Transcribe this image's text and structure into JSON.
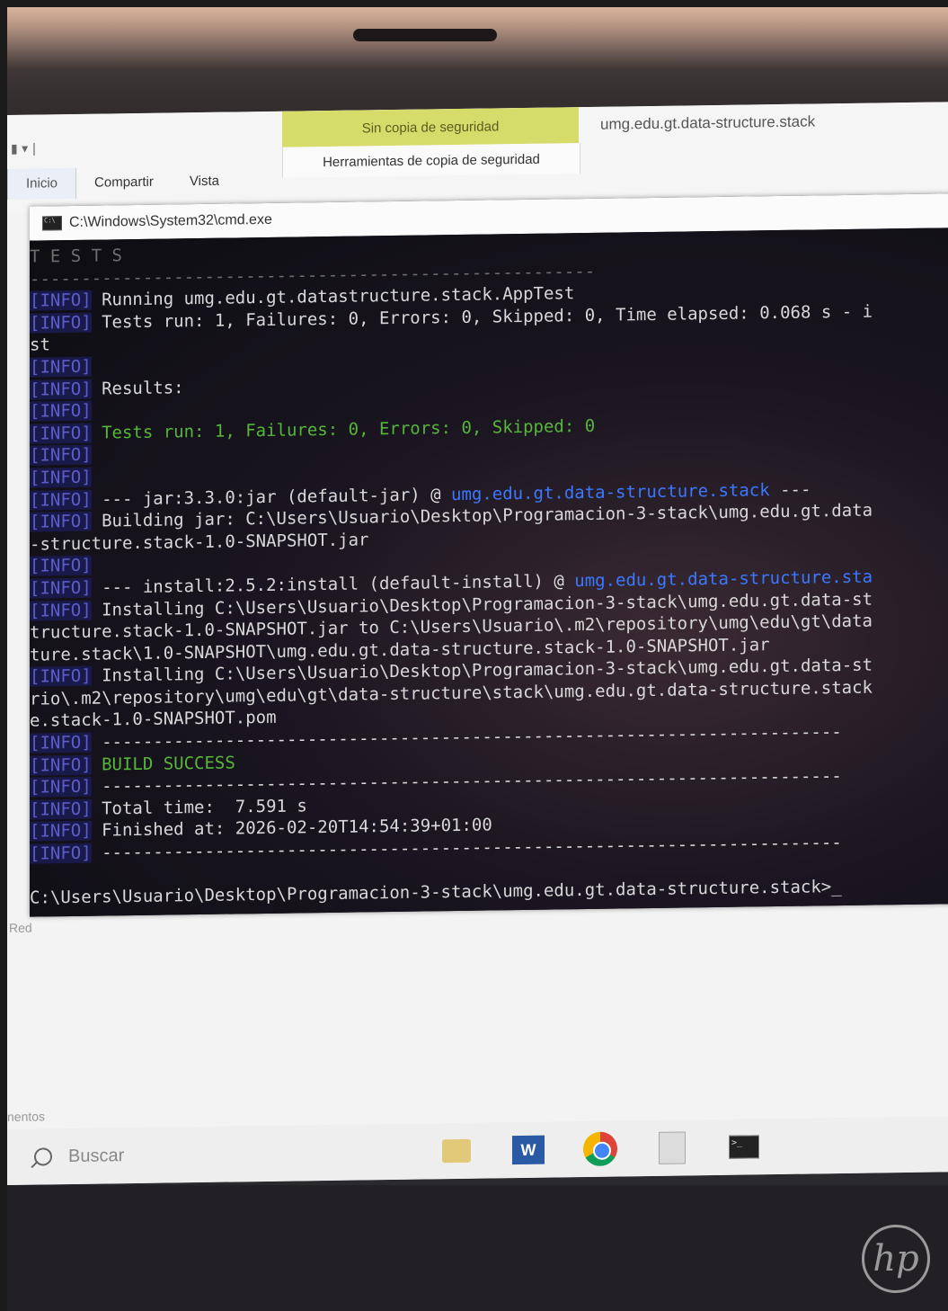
{
  "explorer": {
    "context_tab_top": "Sin copia de seguridad",
    "context_tab_bottom": "Herramientas de copia de seguridad",
    "title": "umg.edu.gt.data-structure.stack",
    "tabs": [
      "Inicio",
      "Compartir",
      "Vista"
    ]
  },
  "cmd": {
    "title": "C:\\Windows\\System32\\cmd.exe",
    "lines": [
      {
        "tag": "",
        "text": "T E S T S",
        "style": "dim"
      },
      {
        "tag": "",
        "text": "-------------------------------------------------------",
        "style": "dim"
      },
      {
        "tag": "[INFO]",
        "text": "Running umg.edu.gt.datastructure.stack.AppTest",
        "style": ""
      },
      {
        "tag": "[INFO]",
        "text": "Tests run: 1, Failures: 0, Errors: 0, Skipped: 0, Time elapsed: 0.068 s - i",
        "style": ""
      },
      {
        "tag": "",
        "text": "st",
        "style": ""
      },
      {
        "tag": "[INFO]",
        "text": "",
        "style": ""
      },
      {
        "tag": "[INFO]",
        "text": "Results:",
        "style": ""
      },
      {
        "tag": "[INFO]",
        "text": "",
        "style": ""
      },
      {
        "tag": "[INFO]",
        "text": "Tests run: 1, Failures: 0, Errors: 0, Skipped: 0",
        "style": "green"
      },
      {
        "tag": "[INFO]",
        "text": "",
        "style": ""
      },
      {
        "tag": "[INFO]",
        "text": "",
        "style": ""
      },
      {
        "tag": "[INFO]",
        "text": "--- jar:3.3.0:jar (default-jar) @ umg.edu.gt.data-structure.stack ---",
        "style": ""
      },
      {
        "tag": "[INFO]",
        "text": "Building jar: C:\\Users\\Usuario\\Desktop\\Programacion-3-stack\\umg.edu.gt.data",
        "style": ""
      },
      {
        "tag": "",
        "text": "-structure.stack-1.0-SNAPSHOT.jar",
        "style": ""
      },
      {
        "tag": "[INFO]",
        "text": "",
        "style": ""
      },
      {
        "tag": "[INFO]",
        "text": "--- install:2.5.2:install (default-install) @ umg.edu.gt.data-structure.sta",
        "style": ""
      },
      {
        "tag": "[INFO]",
        "text": "Installing C:\\Users\\Usuario\\Desktop\\Programacion-3-stack\\umg.edu.gt.data-st",
        "style": ""
      },
      {
        "tag": "",
        "text": "tructure.stack-1.0-SNAPSHOT.jar to C:\\Users\\Usuario\\.m2\\repository\\umg\\edu\\gt\\data",
        "style": ""
      },
      {
        "tag": "",
        "text": "ture.stack\\1.0-SNAPSHOT\\umg.edu.gt.data-structure.stack-1.0-SNAPSHOT.jar",
        "style": ""
      },
      {
        "tag": "[INFO]",
        "text": "Installing C:\\Users\\Usuario\\Desktop\\Programacion-3-stack\\umg.edu.gt.data-st",
        "style": ""
      },
      {
        "tag": "",
        "text": "rio\\.m2\\repository\\umg\\edu\\gt\\data-structure\\stack\\umg.edu.gt.data-structure.stack",
        "style": ""
      },
      {
        "tag": "",
        "text": "e.stack-1.0-SNAPSHOT.pom",
        "style": ""
      },
      {
        "tag": "[INFO]",
        "text": "------------------------------------------------------------------------",
        "style": ""
      },
      {
        "tag": "[INFO]",
        "text": "BUILD SUCCESS",
        "style": "green"
      },
      {
        "tag": "[INFO]",
        "text": "------------------------------------------------------------------------",
        "style": ""
      },
      {
        "tag": "[INFO]",
        "text": "Total time:  7.591 s",
        "style": ""
      },
      {
        "tag": "[INFO]",
        "text": "Finished at: 2026-02-20T14:54:39+01:00",
        "style": ""
      },
      {
        "tag": "[INFO]",
        "text": "------------------------------------------------------------------------",
        "style": ""
      },
      {
        "tag": "",
        "text": "",
        "style": ""
      },
      {
        "tag": "",
        "text": "C:\\Users\\Usuario\\Desktop\\Programacion-3-stack\\umg.edu.gt.data-structure.stack>",
        "style": "prompt"
      }
    ]
  },
  "desktop": {
    "side_labels": [
      "Red",
      "nentos"
    ]
  },
  "taskbar": {
    "search_placeholder": "Buscar"
  },
  "brand": "hp"
}
